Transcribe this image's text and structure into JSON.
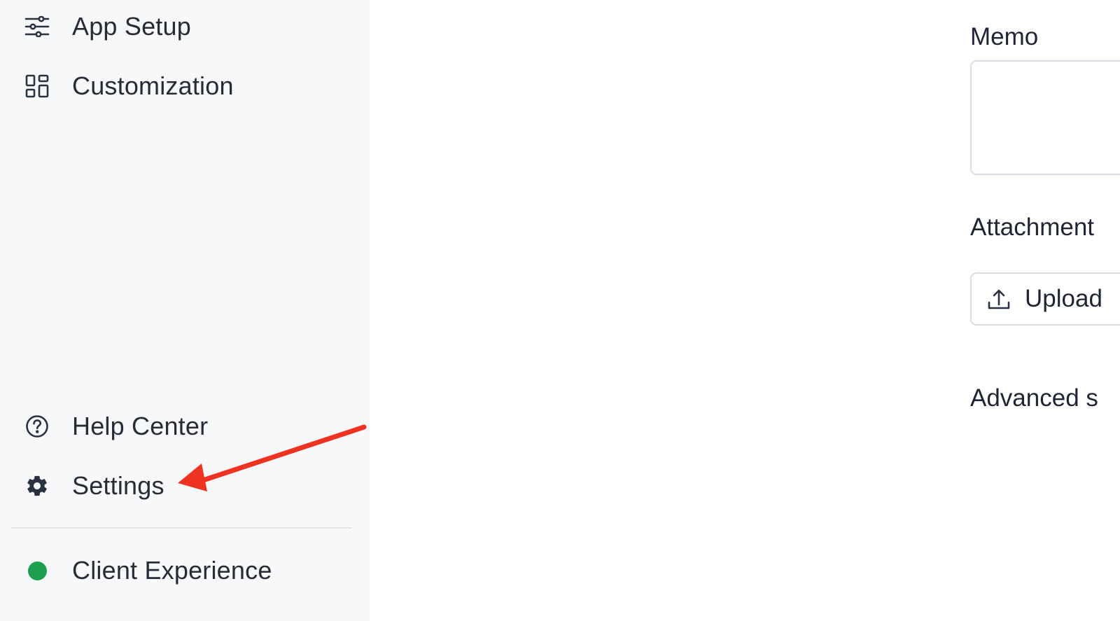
{
  "sidebar": {
    "items": [
      {
        "label": "App Setup",
        "icon": "sliders-icon"
      },
      {
        "label": "Customization",
        "icon": "grid-icon"
      },
      {
        "label": "Help Center",
        "icon": "help-circle-icon"
      },
      {
        "label": "Settings",
        "icon": "gear-icon"
      }
    ],
    "workspace": {
      "label": "Client Experience",
      "status_color": "#1e9e4f"
    }
  },
  "annotation": {
    "arrow_color": "#ee3323"
  },
  "form": {
    "memo_label": "Memo",
    "memo_value": "",
    "attachments_label": "Attachment",
    "upload_label": "Upload",
    "advanced_label": "Advanced s"
  }
}
